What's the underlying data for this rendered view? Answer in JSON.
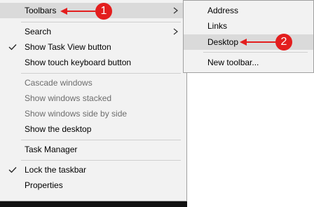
{
  "main_menu": {
    "toolbars": "Toolbars",
    "search": "Search",
    "show_task_view": "Show Task View button",
    "show_touch_keyboard": "Show touch keyboard button",
    "cascade_windows": "Cascade windows",
    "show_windows_stacked": "Show windows stacked",
    "show_windows_side_by_side": "Show windows side by side",
    "show_desktop": "Show the desktop",
    "task_manager": "Task Manager",
    "lock_taskbar": "Lock the taskbar",
    "properties": "Properties"
  },
  "sub_menu": {
    "address": "Address",
    "links": "Links",
    "desktop": "Desktop",
    "new_toolbar": "New toolbar..."
  },
  "callouts": {
    "step1": "1",
    "step2": "2"
  },
  "colors": {
    "accent_red": "#e31e1e",
    "menu_bg": "#f2f2f2",
    "highlight": "#dadada"
  }
}
